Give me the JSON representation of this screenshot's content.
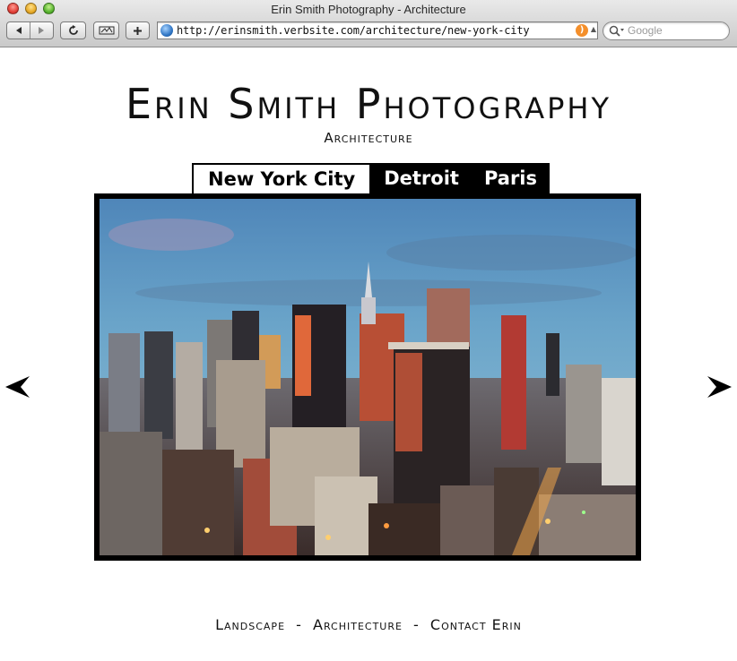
{
  "window": {
    "title": "Erin Smith Photography - Architecture"
  },
  "toolbar": {
    "url": "http://erinsmith.verbsite.com/architecture/new-york-city",
    "search_placeholder": "Google"
  },
  "page": {
    "site_title": "Erin Smith Photography",
    "subtitle": "Architecture",
    "tabs": [
      {
        "label": "New York City",
        "active": true
      },
      {
        "label": "Detroit",
        "active": false
      },
      {
        "label": "Paris",
        "active": false
      }
    ],
    "footer_nav": [
      {
        "label": "Landscape"
      },
      {
        "label": "Architecture"
      },
      {
        "label": "Contact Erin"
      }
    ],
    "footer_separator": "-"
  },
  "icons": {
    "prev": "prev-arrow-icon",
    "next": "next-arrow-icon"
  },
  "colors": {
    "page_bg": "#ffffff",
    "tab_bar_bg": "#000000",
    "tab_active_bg": "#ffffff",
    "text": "#111111",
    "rss": "#f48f2b"
  }
}
